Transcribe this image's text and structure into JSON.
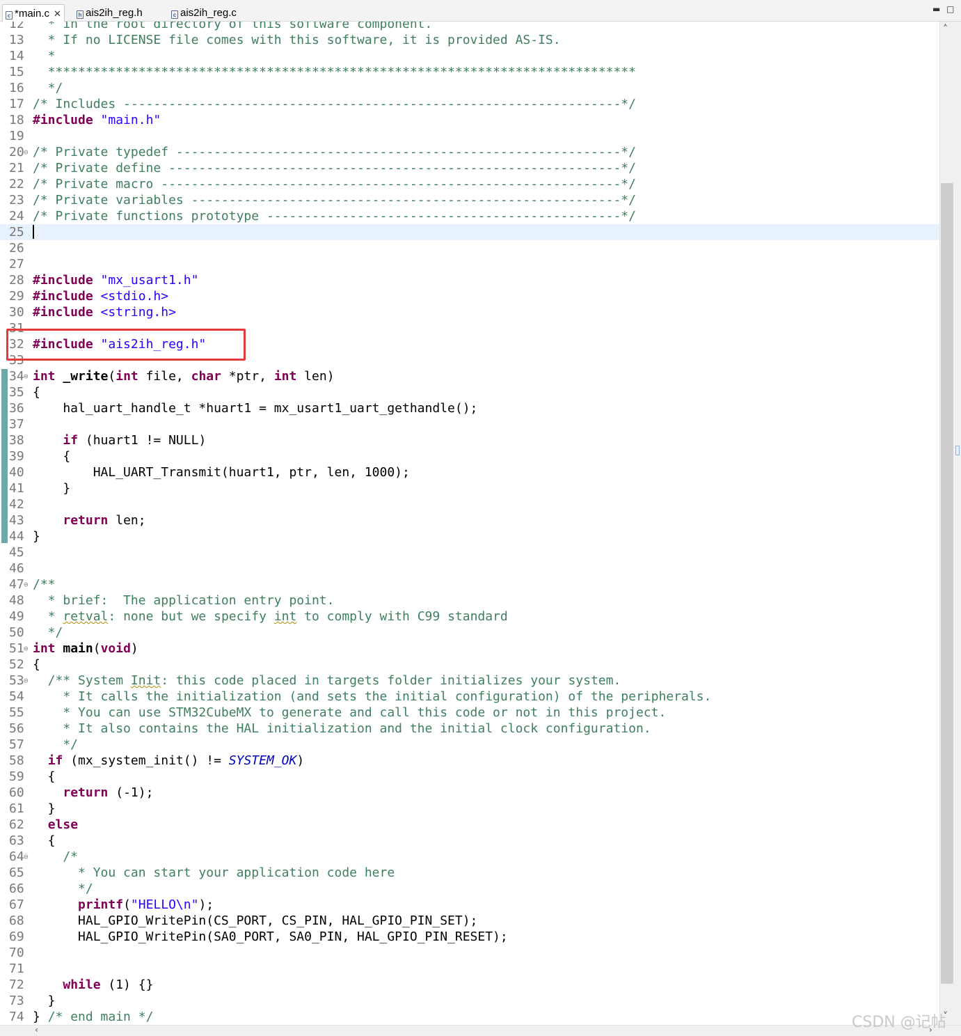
{
  "tabs": [
    {
      "label": "*main.c",
      "active": true,
      "closable": true
    },
    {
      "label": "ais2ih_reg.h",
      "active": false
    },
    {
      "label": "ais2ih_reg.c",
      "active": false
    }
  ],
  "window_controls": {
    "minimize": "▬",
    "maximize": "□"
  },
  "colors": {
    "keyword": "#7f0055",
    "comment": "#3f7f5f",
    "string": "#2a00ff",
    "constant": "#0000c0",
    "highlight_box": "#e23b3b",
    "current_line": "#e8f2fe"
  },
  "editor": {
    "current_line": 25,
    "highlighted_line": 32,
    "lines": [
      {
        "n": "12",
        "fold": false,
        "segs": [
          [
            "cm",
            "  * in the root directory of this software component."
          ]
        ]
      },
      {
        "n": "13",
        "fold": false,
        "segs": [
          [
            "cm",
            "  * If no LICENSE file comes with this software, it is provided AS-IS."
          ]
        ]
      },
      {
        "n": "14",
        "fold": false,
        "segs": [
          [
            "cm",
            "  *"
          ]
        ]
      },
      {
        "n": "15",
        "fold": false,
        "segs": [
          [
            "cm",
            "  ******************************************************************************"
          ]
        ]
      },
      {
        "n": "16",
        "fold": false,
        "segs": [
          [
            "cm",
            "  */"
          ]
        ]
      },
      {
        "n": "17",
        "fold": false,
        "segs": [
          [
            "cm",
            "/* Includes ------------------------------------------------------------------*/"
          ]
        ]
      },
      {
        "n": "18",
        "fold": false,
        "segs": [
          [
            "kw",
            "#include"
          ],
          [
            "",
            " "
          ],
          [
            "st",
            "\"main.h\""
          ]
        ]
      },
      {
        "n": "19",
        "fold": false,
        "segs": []
      },
      {
        "n": "20",
        "fold": true,
        "segs": [
          [
            "cm",
            "/* Private typedef -----------------------------------------------------------*/"
          ]
        ]
      },
      {
        "n": "21",
        "fold": false,
        "segs": [
          [
            "cm",
            "/* Private define ------------------------------------------------------------*/"
          ]
        ]
      },
      {
        "n": "22",
        "fold": false,
        "segs": [
          [
            "cm",
            "/* Private macro -------------------------------------------------------------*/"
          ]
        ]
      },
      {
        "n": "23",
        "fold": false,
        "segs": [
          [
            "cm",
            "/* Private variables ---------------------------------------------------------*/"
          ]
        ]
      },
      {
        "n": "24",
        "fold": false,
        "segs": [
          [
            "cm",
            "/* Private functions prototype -----------------------------------------------*/"
          ]
        ]
      },
      {
        "n": "25",
        "fold": false,
        "segs": []
      },
      {
        "n": "26",
        "fold": false,
        "segs": []
      },
      {
        "n": "27",
        "fold": false,
        "segs": []
      },
      {
        "n": "28",
        "fold": false,
        "segs": [
          [
            "kw",
            "#include"
          ],
          [
            "",
            " "
          ],
          [
            "st",
            "\"mx_usart1.h\""
          ]
        ]
      },
      {
        "n": "29",
        "fold": false,
        "segs": [
          [
            "kw",
            "#include"
          ],
          [
            "",
            " "
          ],
          [
            "st",
            "<stdio.h>"
          ]
        ]
      },
      {
        "n": "30",
        "fold": false,
        "segs": [
          [
            "kw",
            "#include"
          ],
          [
            "",
            " "
          ],
          [
            "st",
            "<string.h>"
          ]
        ]
      },
      {
        "n": "31",
        "fold": false,
        "segs": []
      },
      {
        "n": "32",
        "fold": false,
        "segs": [
          [
            "kw",
            "#include"
          ],
          [
            "",
            " "
          ],
          [
            "st",
            "\"ais2ih_reg.h\""
          ]
        ]
      },
      {
        "n": "33",
        "fold": false,
        "segs": []
      },
      {
        "n": "34",
        "fold": true,
        "segs": [
          [
            "kw",
            "int"
          ],
          [
            "",
            " "
          ],
          [
            "fn",
            "_write"
          ],
          [
            "",
            "("
          ],
          [
            "kw",
            "int"
          ],
          [
            "",
            " file, "
          ],
          [
            "kw",
            "char"
          ],
          [
            "",
            " *ptr, "
          ],
          [
            "kw",
            "int"
          ],
          [
            "",
            " len)"
          ]
        ]
      },
      {
        "n": "35",
        "fold": false,
        "segs": [
          [
            "",
            "{"
          ]
        ]
      },
      {
        "n": "36",
        "fold": false,
        "segs": [
          [
            "",
            "    hal_uart_handle_t *huart1 = mx_usart1_uart_gethandle();"
          ]
        ]
      },
      {
        "n": "37",
        "fold": false,
        "segs": []
      },
      {
        "n": "38",
        "fold": false,
        "segs": [
          [
            "",
            "    "
          ],
          [
            "kw",
            "if"
          ],
          [
            "",
            " (huart1 != NULL)"
          ]
        ]
      },
      {
        "n": "39",
        "fold": false,
        "segs": [
          [
            "",
            "    {"
          ]
        ]
      },
      {
        "n": "40",
        "fold": false,
        "segs": [
          [
            "",
            "        HAL_UART_Transmit(huart1, ptr, len, 1000);"
          ]
        ]
      },
      {
        "n": "41",
        "fold": false,
        "segs": [
          [
            "",
            "    }"
          ]
        ]
      },
      {
        "n": "42",
        "fold": false,
        "segs": []
      },
      {
        "n": "43",
        "fold": false,
        "segs": [
          [
            "",
            "    "
          ],
          [
            "kw",
            "return"
          ],
          [
            "",
            " len;"
          ]
        ]
      },
      {
        "n": "44",
        "fold": false,
        "segs": [
          [
            "",
            "}"
          ]
        ]
      },
      {
        "n": "45",
        "fold": false,
        "segs": []
      },
      {
        "n": "46",
        "fold": false,
        "segs": []
      },
      {
        "n": "47",
        "fold": true,
        "segs": [
          [
            "cm",
            "/**"
          ]
        ]
      },
      {
        "n": "48",
        "fold": false,
        "segs": [
          [
            "cm",
            "  * brief:  The application entry point."
          ]
        ]
      },
      {
        "n": "49",
        "fold": false,
        "segs": [
          [
            "cm",
            "  * "
          ],
          [
            "cm sq",
            "retval"
          ],
          [
            "cm",
            ": none but we specify "
          ],
          [
            "cm sq",
            "int"
          ],
          [
            "cm",
            " to comply with C99 standard"
          ]
        ]
      },
      {
        "n": "50",
        "fold": false,
        "segs": [
          [
            "cm",
            "  */"
          ]
        ]
      },
      {
        "n": "51",
        "fold": true,
        "segs": [
          [
            "kw",
            "int"
          ],
          [
            "",
            " "
          ],
          [
            "fn",
            "main"
          ],
          [
            "",
            "("
          ],
          [
            "kw",
            "void"
          ],
          [
            "",
            ")"
          ]
        ]
      },
      {
        "n": "52",
        "fold": false,
        "segs": [
          [
            "",
            "{"
          ]
        ]
      },
      {
        "n": "53",
        "fold": true,
        "segs": [
          [
            "cm",
            "  /** System "
          ],
          [
            "cm sq",
            "Init"
          ],
          [
            "cm",
            ": this code placed in targets folder initializes your system."
          ]
        ]
      },
      {
        "n": "54",
        "fold": false,
        "segs": [
          [
            "cm",
            "    * It calls the initialization (and sets the initial configuration) of the peripherals."
          ]
        ]
      },
      {
        "n": "55",
        "fold": false,
        "segs": [
          [
            "cm",
            "    * You can use STM32CubeMX to generate and call this code or not in this project."
          ]
        ]
      },
      {
        "n": "56",
        "fold": false,
        "segs": [
          [
            "cm",
            "    * It also contains the HAL initialization and the initial clock configuration."
          ]
        ]
      },
      {
        "n": "57",
        "fold": false,
        "segs": [
          [
            "cm",
            "    */"
          ]
        ]
      },
      {
        "n": "58",
        "fold": false,
        "segs": [
          [
            "",
            "  "
          ],
          [
            "kw",
            "if"
          ],
          [
            "",
            " (mx_system_init() != "
          ],
          [
            "const",
            "SYSTEM_OK"
          ],
          [
            "",
            ")"
          ]
        ]
      },
      {
        "n": "59",
        "fold": false,
        "segs": [
          [
            "",
            "  {"
          ]
        ]
      },
      {
        "n": "60",
        "fold": false,
        "segs": [
          [
            "",
            "    "
          ],
          [
            "kw",
            "return"
          ],
          [
            "",
            " (-1);"
          ]
        ]
      },
      {
        "n": "61",
        "fold": false,
        "segs": [
          [
            "",
            "  }"
          ]
        ]
      },
      {
        "n": "62",
        "fold": false,
        "segs": [
          [
            "",
            "  "
          ],
          [
            "kw",
            "else"
          ]
        ]
      },
      {
        "n": "63",
        "fold": false,
        "segs": [
          [
            "",
            "  {"
          ]
        ]
      },
      {
        "n": "64",
        "fold": true,
        "segs": [
          [
            "cm",
            "    /*"
          ]
        ]
      },
      {
        "n": "65",
        "fold": false,
        "segs": [
          [
            "cm",
            "      * You can start your application code here"
          ]
        ]
      },
      {
        "n": "66",
        "fold": false,
        "segs": [
          [
            "cm",
            "      */"
          ]
        ]
      },
      {
        "n": "67",
        "fold": false,
        "segs": [
          [
            "",
            "      "
          ],
          [
            "kw",
            "printf"
          ],
          [
            "",
            "("
          ],
          [
            "st",
            "\"HELLO\\n\""
          ],
          [
            "",
            ");"
          ]
        ]
      },
      {
        "n": "68",
        "fold": false,
        "segs": [
          [
            "",
            "      HAL_GPIO_WritePin(CS_PORT, CS_PIN, HAL_GPIO_PIN_SET);"
          ]
        ]
      },
      {
        "n": "69",
        "fold": false,
        "segs": [
          [
            "",
            "      HAL_GPIO_WritePin(SA0_PORT, SA0_PIN, HAL_GPIO_PIN_RESET);"
          ]
        ]
      },
      {
        "n": "70",
        "fold": false,
        "segs": []
      },
      {
        "n": "71",
        "fold": false,
        "segs": []
      },
      {
        "n": "72",
        "fold": false,
        "segs": [
          [
            "",
            "    "
          ],
          [
            "kw",
            "while"
          ],
          [
            "",
            " (1) {}"
          ]
        ]
      },
      {
        "n": "73",
        "fold": false,
        "segs": [
          [
            "",
            "  }"
          ]
        ]
      },
      {
        "n": "74",
        "fold": false,
        "segs": [
          [
            "",
            "} "
          ],
          [
            "cm",
            "/* end main */"
          ]
        ]
      }
    ]
  },
  "watermark": "CSDN @记帖"
}
